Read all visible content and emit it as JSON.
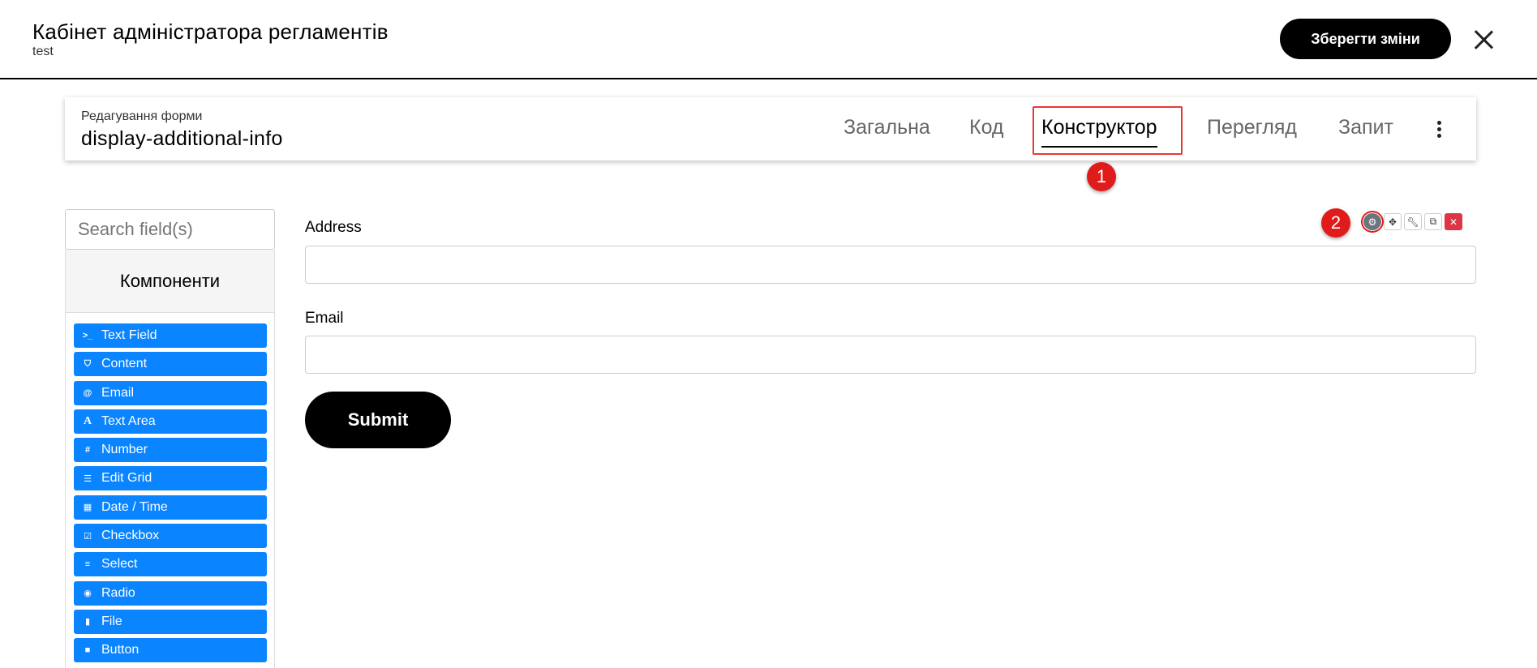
{
  "header": {
    "title": "Кабінет адміністратора регламентів",
    "subtitle": "test",
    "save_label": "Зберегти зміни"
  },
  "form": {
    "edit_label": "Редагування форми",
    "name": "display-additional-info"
  },
  "tabs": [
    {
      "label": "Загальна"
    },
    {
      "label": "Код"
    },
    {
      "label": "Конструктор"
    },
    {
      "label": "Перегляд"
    },
    {
      "label": "Запит"
    }
  ],
  "active_tab": "Конструктор",
  "markers": {
    "one": "1",
    "two": "2"
  },
  "sidebar": {
    "search_placeholder": "Search field(s)",
    "components_title": "Компоненти",
    "components": [
      {
        "label": "Text Field",
        "icon": "terminal-icon"
      },
      {
        "label": "Content",
        "icon": "html5-icon"
      },
      {
        "label": "Email",
        "icon": "at-icon"
      },
      {
        "label": "Text Area",
        "icon": "font-icon"
      },
      {
        "label": "Number",
        "icon": "hashtag-icon"
      },
      {
        "label": "Edit Grid",
        "icon": "tasks-icon"
      },
      {
        "label": "Date / Time",
        "icon": "calendar-icon"
      },
      {
        "label": "Checkbox",
        "icon": "check-square-icon"
      },
      {
        "label": "Select",
        "icon": "list-icon"
      },
      {
        "label": "Radio",
        "icon": "dot-circle-icon"
      },
      {
        "label": "File",
        "icon": "file-icon"
      },
      {
        "label": "Button",
        "icon": "stop-icon"
      }
    ]
  },
  "builder": {
    "fields": [
      {
        "label": "Address",
        "value": ""
      },
      {
        "label": "Email",
        "value": ""
      }
    ],
    "submit_label": "Submit",
    "tools": [
      "gear-icon",
      "move-icon",
      "wrench-icon",
      "copy-icon",
      "remove-icon"
    ]
  },
  "colors": {
    "accent": "#0a84ff",
    "marker": "#e01b1b",
    "danger": "#dc3545"
  }
}
